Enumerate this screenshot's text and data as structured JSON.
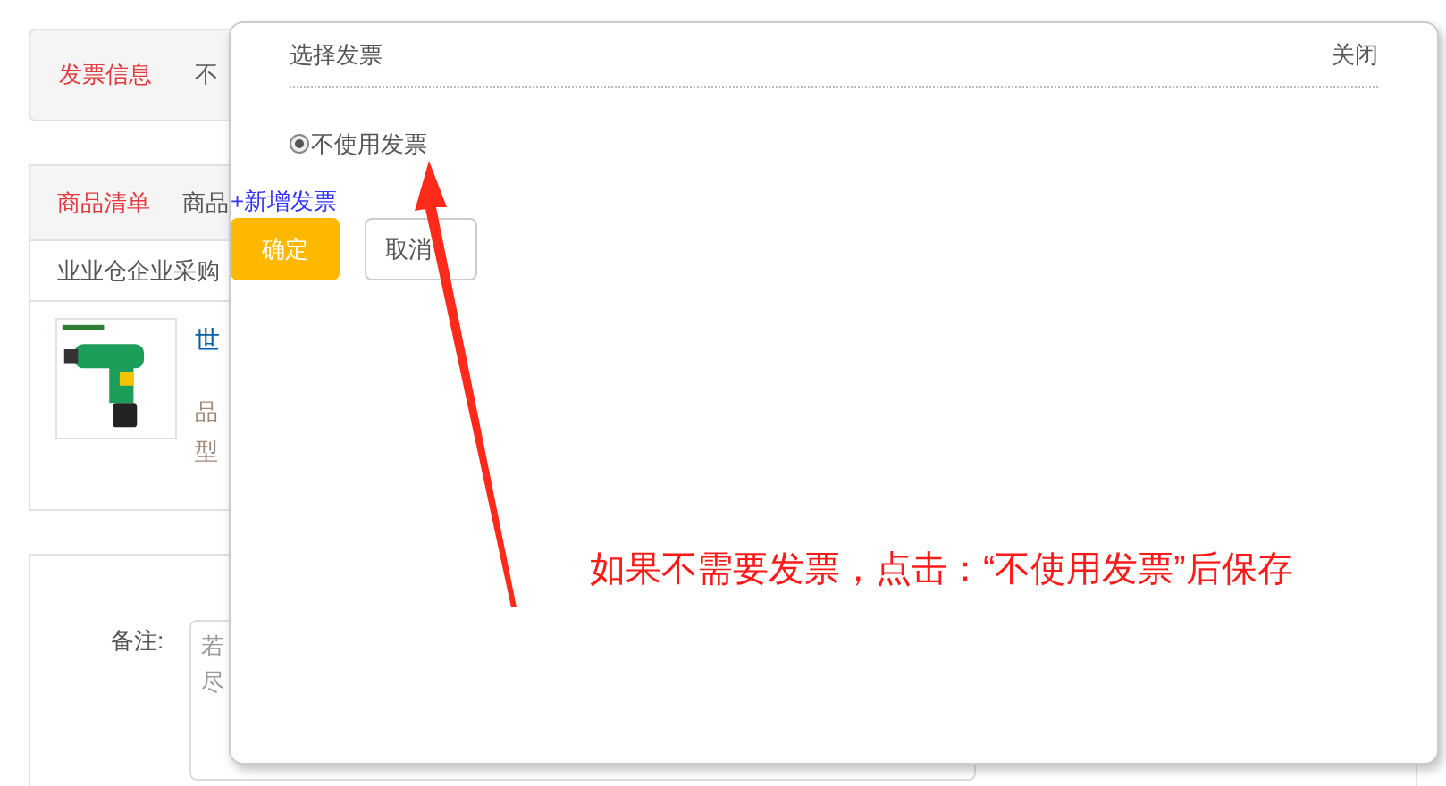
{
  "invoice_panel": {
    "label": "发票信息",
    "value": "不"
  },
  "goods_panel": {
    "tabs": [
      {
        "label": "商品清单",
        "selected": true
      },
      {
        "label": "商品",
        "selected": false
      }
    ],
    "supplier": "业业仓企业采购",
    "product": {
      "name": "世",
      "brand_label": "品",
      "model_label": "型"
    }
  },
  "remark": {
    "label": "备注:",
    "placeholder_lines": [
      "若",
      "尽"
    ]
  },
  "dialog": {
    "title": "选择发票",
    "close": "关闭",
    "options": [
      {
        "label": "不使用发票",
        "selected": true
      }
    ],
    "add_link": "+新增发票",
    "buttons": [
      {
        "label": "确定",
        "kind": "primary"
      },
      {
        "label": "取消",
        "kind": "secondary"
      }
    ]
  },
  "annotation": {
    "text": "如果不需要发票，点击：“不使用发票”后保存"
  }
}
